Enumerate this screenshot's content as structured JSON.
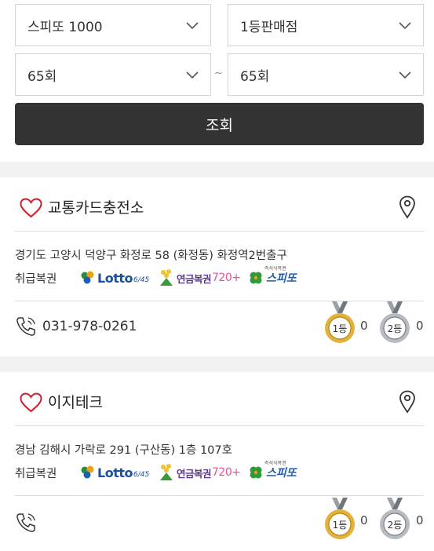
{
  "filters": {
    "game": "스피또 1000",
    "rank": "1등판매점",
    "round_from": "65회",
    "round_to": "65회",
    "range_separator": "~",
    "search_label": "조회"
  },
  "colors": {
    "button_bg": "#333333",
    "heart": "#c8202f",
    "gold": "#e3b23c",
    "silver": "#b8bcc0",
    "divider": "#dcdcdc",
    "gap_bg": "#f2f2f2"
  },
  "stores": [
    {
      "name": "교통카드충전소",
      "address": "경기도 고양시 덕양구 화정로 58 (화정동) 화정역2번출구",
      "lottery_label": "취급복권",
      "phone": "031-978-0261",
      "first_prize_count": "0",
      "second_prize_count": "0"
    },
    {
      "name": "이지테크",
      "address": "경남 김해시 가락로 291 (구산동) 1층 107호",
      "lottery_label": "취급복권",
      "phone": "",
      "first_prize_count": "0",
      "second_prize_count": "0"
    }
  ],
  "lottery_logos": {
    "lotto_word": "Lotto",
    "lotto_suffix": "6/45",
    "pension_word": "연금복권",
    "pension_num": "720+",
    "speetto_word": "스피또",
    "speetto_small": "즉석식복권"
  },
  "medals": {
    "first_label": "1등",
    "second_label": "2등"
  }
}
